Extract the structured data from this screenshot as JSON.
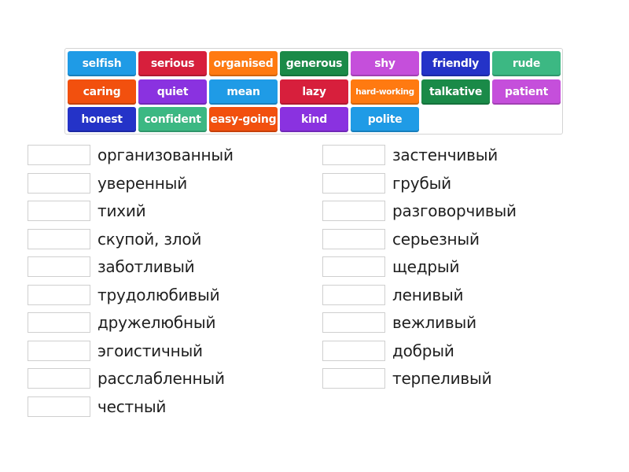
{
  "tiles": [
    {
      "label": "selfish",
      "color": "#1f9be6"
    },
    {
      "label": "serious",
      "color": "#d71f3c"
    },
    {
      "label": "organised",
      "color": "#ff7a11"
    },
    {
      "label": "generous",
      "color": "#1a8a48"
    },
    {
      "label": "shy",
      "color": "#c54fdb"
    },
    {
      "label": "friendly",
      "color": "#2433c8"
    },
    {
      "label": "rude",
      "color": "#3cb883"
    },
    {
      "label": "caring",
      "color": "#f2500e"
    },
    {
      "label": "quiet",
      "color": "#8a32e0"
    },
    {
      "label": "mean",
      "color": "#1f9be6"
    },
    {
      "label": "lazy",
      "color": "#d71f3c"
    },
    {
      "label": "hard-working",
      "color": "#ff7a11"
    },
    {
      "label": "talkative",
      "color": "#1a8a48"
    },
    {
      "label": "patient",
      "color": "#c54fdb"
    },
    {
      "label": "honest",
      "color": "#2433c8"
    },
    {
      "label": "confident",
      "color": "#3cb883"
    },
    {
      "label": "easy-going",
      "color": "#f2500e"
    },
    {
      "label": "kind",
      "color": "#8a32e0"
    },
    {
      "label": "polite",
      "color": "#1f9be6"
    }
  ],
  "left_column": [
    {
      "label": "организованный",
      "answer": ""
    },
    {
      "label": "уверенный",
      "answer": ""
    },
    {
      "label": "тихий",
      "answer": ""
    },
    {
      "label": "скупой, злой",
      "answer": ""
    },
    {
      "label": "заботливый",
      "answer": ""
    },
    {
      "label": "трудолюбивый",
      "answer": ""
    },
    {
      "label": "дружелюбный",
      "answer": ""
    },
    {
      "label": "эгоистичный",
      "answer": ""
    },
    {
      "label": "расслабленный",
      "answer": ""
    },
    {
      "label": "честный",
      "answer": ""
    }
  ],
  "right_column": [
    {
      "label": "застенчивый",
      "answer": ""
    },
    {
      "label": "грубый",
      "answer": ""
    },
    {
      "label": "разговорчивый",
      "answer": ""
    },
    {
      "label": "серьезный",
      "answer": ""
    },
    {
      "label": "щедрый",
      "answer": ""
    },
    {
      "label": "ленивый",
      "answer": ""
    },
    {
      "label": "вежливый",
      "answer": ""
    },
    {
      "label": "добрый",
      "answer": ""
    },
    {
      "label": "терпеливый",
      "answer": ""
    }
  ]
}
